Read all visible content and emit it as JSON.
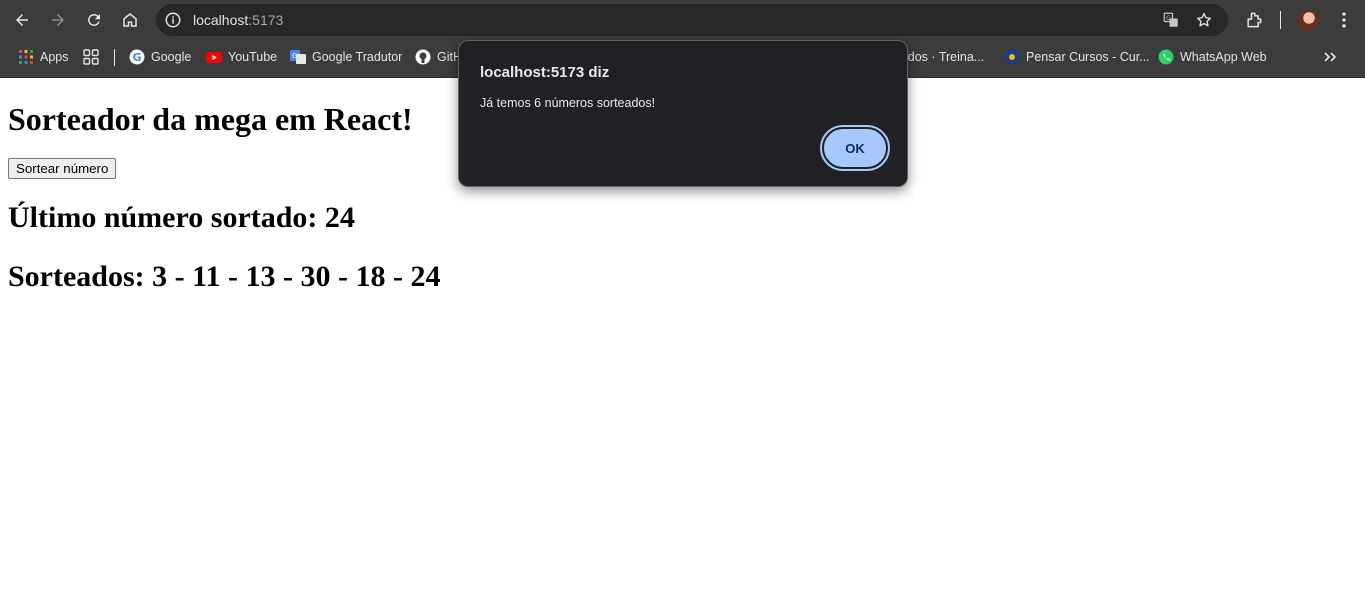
{
  "browser": {
    "url_host": "localhost",
    "url_port": ":5173",
    "icons": [
      "back-icon",
      "forward-icon",
      "reload-icon",
      "home-icon",
      "site-info-icon",
      "translate-icon",
      "bookmark-star-icon",
      "extensions-icon",
      "profile-avatar",
      "menu-dots-icon"
    ]
  },
  "bookmarks": [
    {
      "label": "Apps",
      "icon": "apps-grid-icon"
    },
    {
      "label": "",
      "icon": "tab-groups-icon"
    },
    {
      "label": "Google",
      "icon": "google-icon"
    },
    {
      "label": "YouTube",
      "icon": "youtube-icon"
    },
    {
      "label": "Google Tradutor",
      "icon": "google-translate-icon"
    },
    {
      "label": "GitH",
      "icon": "github-icon"
    },
    {
      "label": "idos · Treina...",
      "icon": ""
    },
    {
      "label": "Pensar Cursos - Cur...",
      "icon": "pensar-cursos-icon"
    },
    {
      "label": "WhatsApp Web",
      "icon": "whatsapp-icon"
    },
    {
      "label": "",
      "icon": "more-bookmarks-icon"
    }
  ],
  "page": {
    "heading": "Sorteador da mega em React!",
    "draw_button": "Sortear número",
    "last_number": "Último número sortado: 24",
    "drawn_numbers": "Sorteados: 3 - 11 - 13 - 30 - 18 - 24"
  },
  "dialog": {
    "title": "localhost:5173 diz",
    "message": "Já temos 6 números sorteados!",
    "ok_label": "OK"
  },
  "colors": {
    "chrome_bg": "#3c3c3c",
    "omnibox_bg": "#282828",
    "dialog_bg": "#202124",
    "ok_button": "#a8c7fa"
  }
}
